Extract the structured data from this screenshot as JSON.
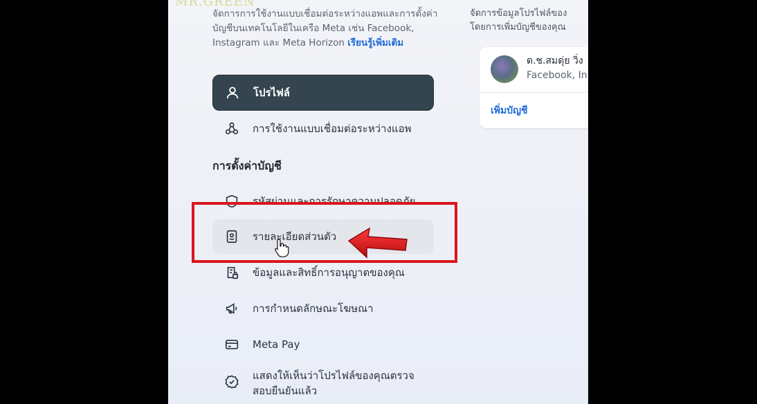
{
  "watermark": "MR.GREEN",
  "left": {
    "description": "จัดการการใช้งานแบบเชื่อมต่อระหว่างแอพและการตั้งค่าบัญชีบนเทคโนโลยีในเครือ Meta เช่น Facebook, Instagram และ Meta Horizon",
    "learn_more": "เรียนรู้เพิ่มเติม",
    "items": [
      {
        "label": "โปรไฟล์",
        "icon": "person-icon"
      },
      {
        "label": "การใช้งานแบบเชื่อมต่อระหว่างแอพ",
        "icon": "connected-nodes-icon"
      }
    ],
    "section_title": "การตั้งค่าบัญชี",
    "settings": [
      {
        "label": "รหัสผ่านและการรักษาความปลอดภัย",
        "icon": "shield-icon"
      },
      {
        "label": "รายละเอียดส่วนตัว",
        "icon": "id-card-icon"
      },
      {
        "label": "ข้อมูลและสิทธิ์การอนุญาตของคุณ",
        "icon": "document-lock-icon"
      },
      {
        "label": "การกำหนดลักษณะโฆษณา",
        "icon": "megaphone-icon"
      },
      {
        "label": "Meta Pay",
        "icon": "credit-card-icon"
      },
      {
        "label": "แสดงให้เห็นว่าโปรไฟล์ของคุณตรวจสอบยืนยันแล้ว",
        "icon": "verified-badge-icon"
      }
    ]
  },
  "right": {
    "description_line1": "จัดการข้อมูลโปรไฟล์ของ",
    "description_line2": "โดยการเพิ่มบัญชีของคุณ",
    "account_name": "ด.ช.สมดุ่ย วิ่ง",
    "account_platform": "Facebook, In",
    "add_account": "เพิ่มบัญชี"
  },
  "colors": {
    "active_item_bg": "#344550",
    "link": "#1d6bd8",
    "highlight_box": "#d9161c"
  }
}
